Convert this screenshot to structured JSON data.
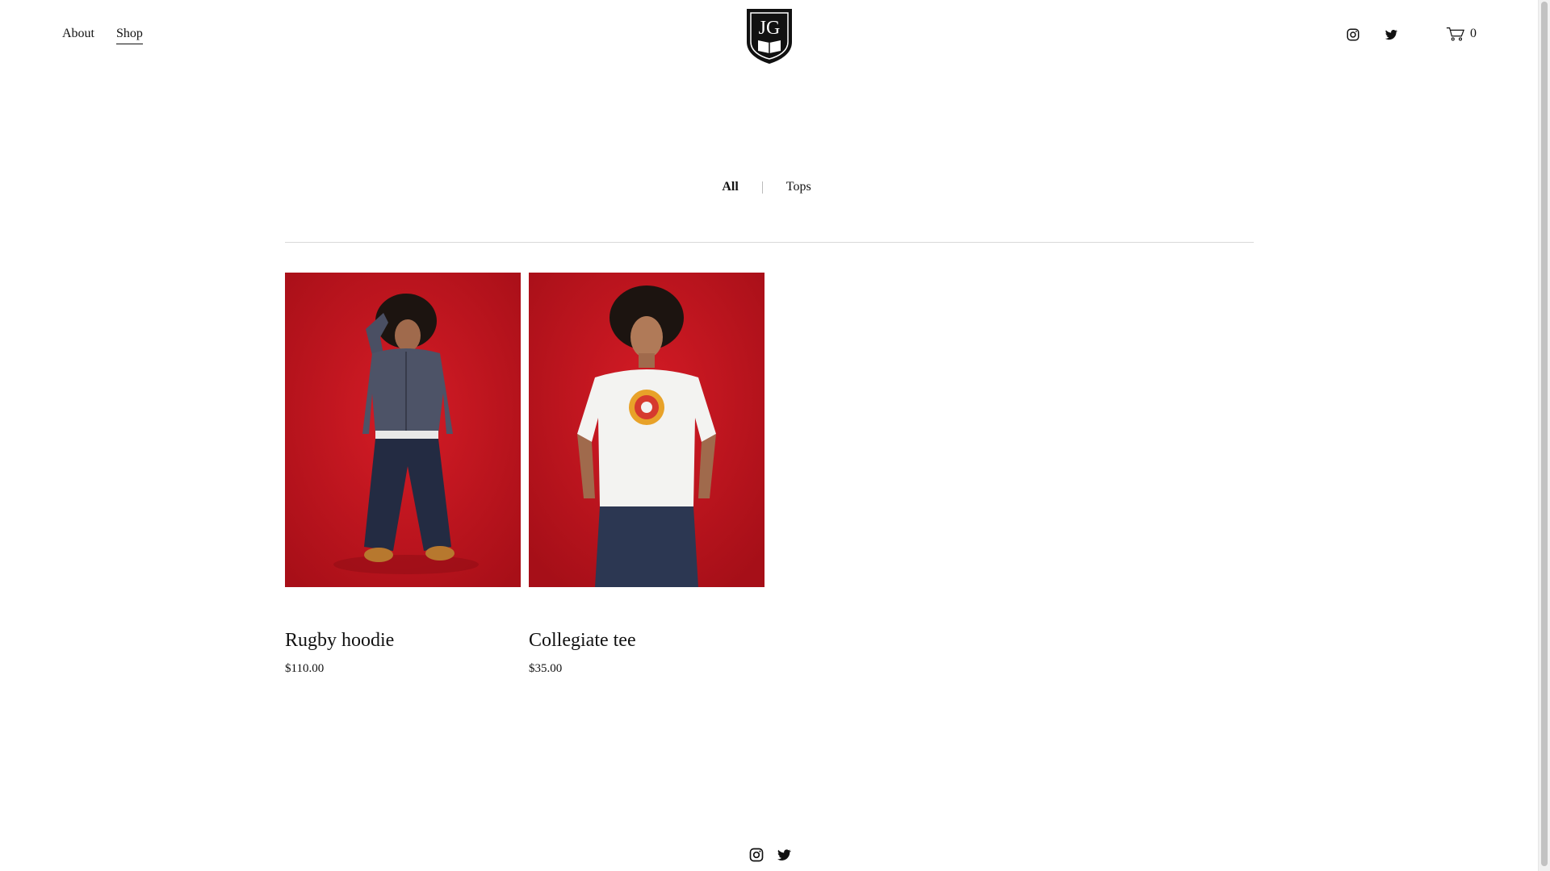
{
  "header": {
    "nav": [
      {
        "label": "About",
        "active": false
      },
      {
        "label": "Shop",
        "active": true
      }
    ],
    "logo_text": "JG",
    "cart_count": "0"
  },
  "categories": {
    "items": [
      "All",
      "Tops"
    ],
    "active": "All"
  },
  "products": [
    {
      "name": "Rugby hoodie",
      "price": "$110.00"
    },
    {
      "name": "Collegiate tee",
      "price": "$35.00"
    }
  ],
  "icons": {
    "instagram": "instagram-icon",
    "twitter": "twitter-icon",
    "cart": "cart-icon"
  },
  "colors": {
    "text": "#111111",
    "background": "#ffffff",
    "photo_backdrop": "#c2151f",
    "divider": "#d9d9d9"
  }
}
